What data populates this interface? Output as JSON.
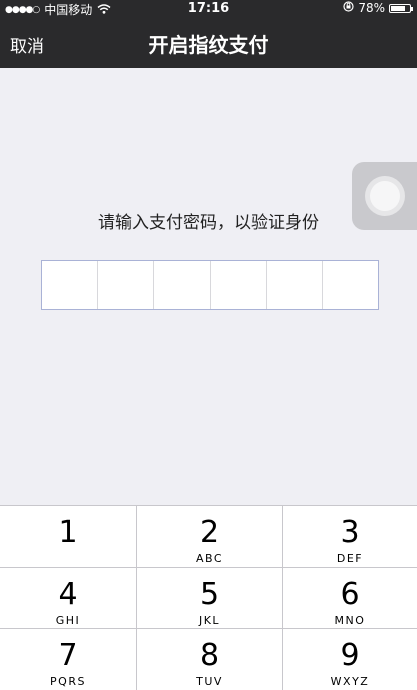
{
  "status_bar": {
    "signal_dots": "●●●●○",
    "carrier": "中国移动",
    "time": "17:16",
    "battery_percent": "78%",
    "battery_level": 0.78
  },
  "nav": {
    "cancel_label": "取消",
    "title": "开启指纹支付"
  },
  "prompt": "请输入支付密码，以验证身份",
  "pin": {
    "length": 6
  },
  "keypad": [
    {
      "num": "1",
      "letters": ""
    },
    {
      "num": "2",
      "letters": "ABC"
    },
    {
      "num": "3",
      "letters": "DEF"
    },
    {
      "num": "4",
      "letters": "GHI"
    },
    {
      "num": "5",
      "letters": "JKL"
    },
    {
      "num": "6",
      "letters": "MNO"
    },
    {
      "num": "7",
      "letters": "PQRS"
    },
    {
      "num": "8",
      "letters": "TUV"
    },
    {
      "num": "9",
      "letters": "WXYZ"
    }
  ],
  "colors": {
    "nav_background": "#2a2a2c",
    "page_background": "#efeff4",
    "pin_border": "#a9b2d6"
  }
}
